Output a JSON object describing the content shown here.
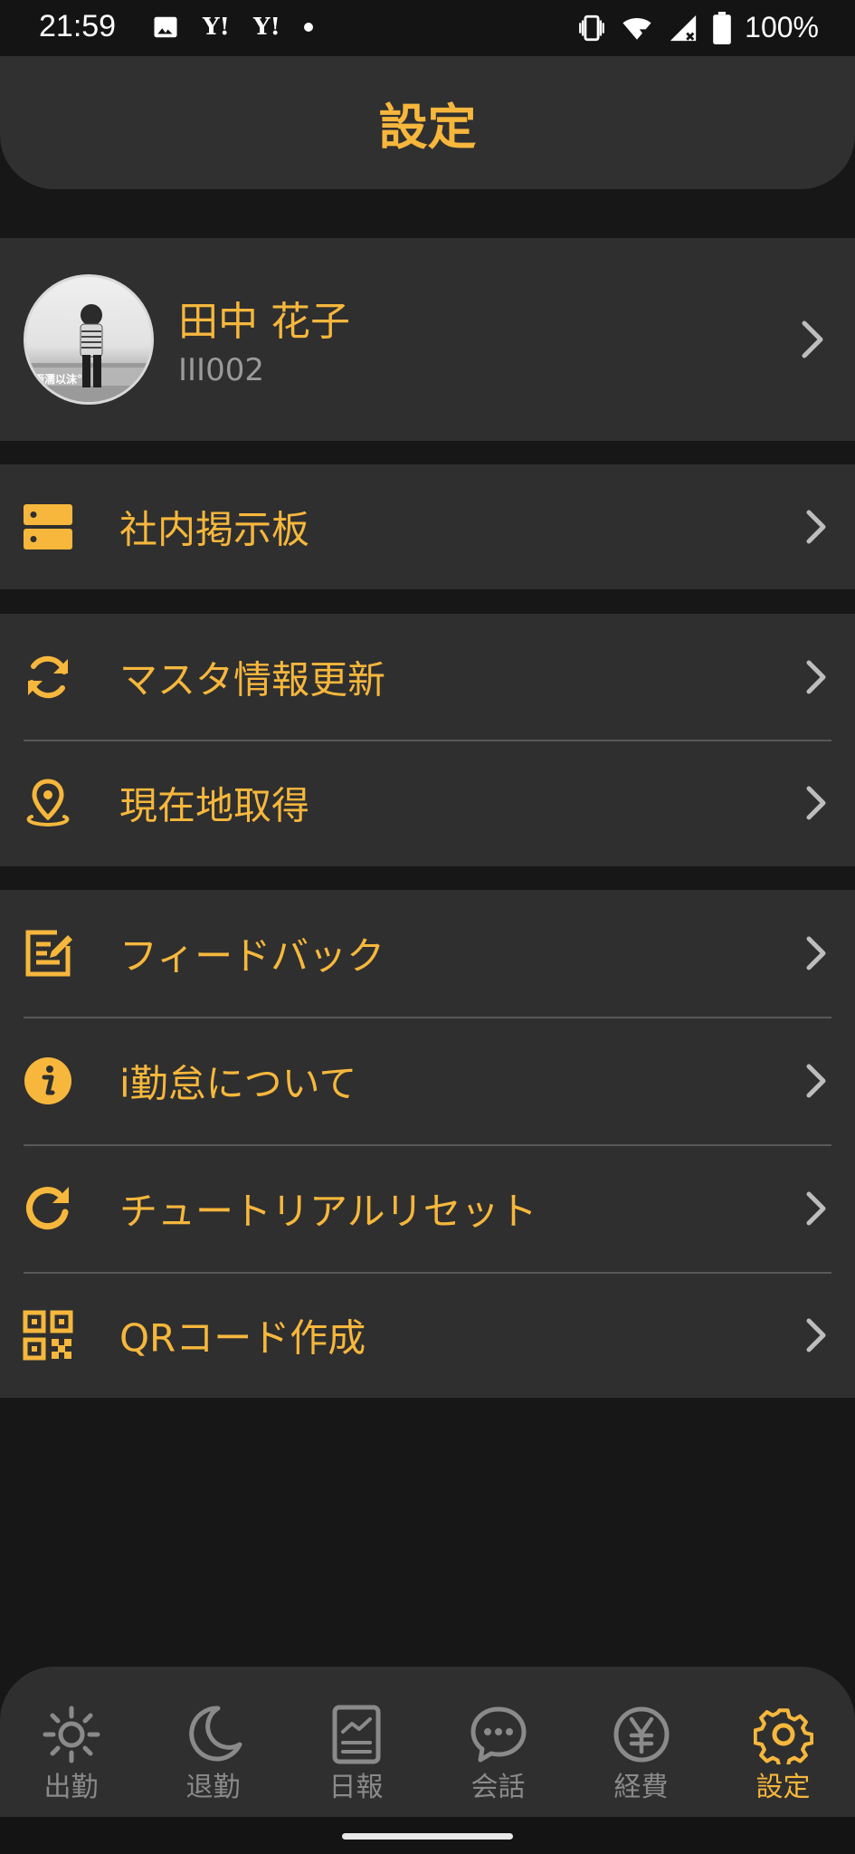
{
  "status_bar": {
    "time": "21:59",
    "battery": "100%",
    "notifications": [
      "image-icon",
      "yahoo-icon",
      "yahoo-icon",
      "dot-icon"
    ],
    "system_icons": [
      "vibrate-icon",
      "wifi-icon",
      "signal-icon",
      "battery-icon"
    ]
  },
  "header": {
    "title": "設定"
  },
  "profile": {
    "name": "田中 花子",
    "user_id": "III002"
  },
  "menu": {
    "bulletin": {
      "label": "社内掲示板",
      "icon": "bulletin-board-icon"
    },
    "master_update": {
      "label": "マスタ情報更新",
      "icon": "sync-icon"
    },
    "location": {
      "label": "現在地取得",
      "icon": "location-pin-icon"
    },
    "feedback": {
      "label": "フィードバック",
      "icon": "edit-icon"
    },
    "about": {
      "label": "i勤怠について",
      "icon": "info-icon"
    },
    "tutorial_reset": {
      "label": "チュートリアルリセット",
      "icon": "refresh-icon"
    },
    "qr_code": {
      "label": "QRコード作成",
      "icon": "qr-code-icon"
    }
  },
  "bottom_nav": {
    "items": [
      {
        "label": "出勤",
        "icon": "sun-icon"
      },
      {
        "label": "退勤",
        "icon": "moon-icon"
      },
      {
        "label": "日報",
        "icon": "report-icon"
      },
      {
        "label": "会話",
        "icon": "chat-icon"
      },
      {
        "label": "経費",
        "icon": "yen-icon"
      },
      {
        "label": "設定",
        "icon": "gear-icon"
      }
    ],
    "active_index": 5
  },
  "colors": {
    "accent": "#f6b73c",
    "background": "#171717",
    "surface": "#2f2f2f",
    "muted_text": "#8a8a8a",
    "chevron": "#bdbdbd"
  }
}
